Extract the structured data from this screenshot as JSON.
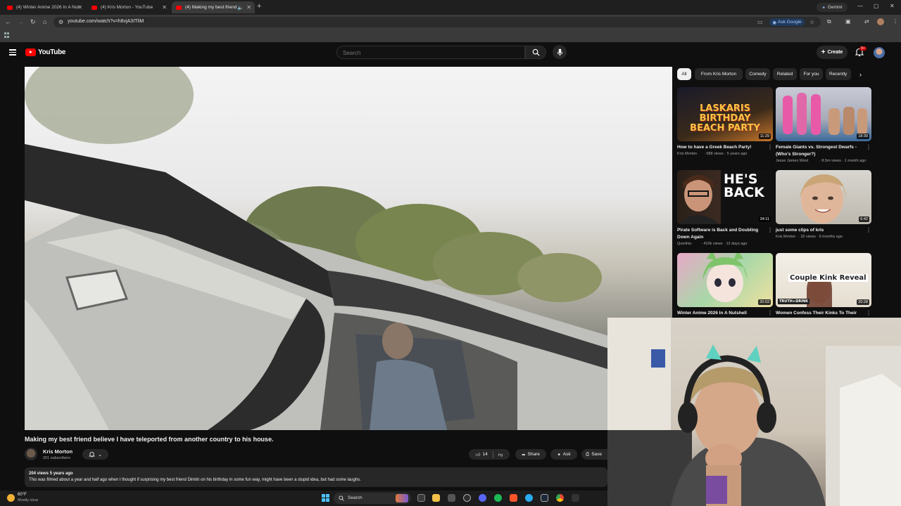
{
  "browser": {
    "tabs": [
      {
        "title": "(4) Winter Anime 2026 In A Nut",
        "active": false
      },
      {
        "title": "(4) Kris Morton - YouTube",
        "active": false
      },
      {
        "title": "(4) Making my best friend",
        "active": true
      }
    ],
    "gemini_label": "Gemini",
    "url": "youtube.com/watch?v=h8vjA3ITliM",
    "ask_google_label": "Ask Google"
  },
  "youtube": {
    "logo_text": "YouTube",
    "search_placeholder": "Search",
    "create_label": "Create",
    "notification_count": "9+"
  },
  "video": {
    "title": "Making my best friend believe I have teleported from another country to his house.",
    "channel_name": "Kris Morton",
    "subscribers": "201 subscribers",
    "likes": "14",
    "share_label": "Share",
    "ask_label": "Ask",
    "save_label": "Save",
    "views_date": "204 views  5 years ago",
    "description": "This was filmed about a year and half ago when I thought if surprising my best friend Dimitri on his birthday in some fun way, might have been a stupid idea, but had some laughs."
  },
  "chips": [
    "All",
    "From Kris Morton",
    "Comedy",
    "Related",
    "For you",
    "Recently"
  ],
  "recommendations": [
    {
      "title": "How to have a Greek Beach Party!",
      "channel": "Kris Morton",
      "meta": "588 views · 5 years ago",
      "duration": "11:29",
      "thumb_text": "LASKARIS BIRTHDAY BEACH PARTY"
    },
    {
      "title": "Female Giants vs. Strongest Dwarfs - (Who's Stronger?)",
      "channel": "Jesse James West",
      "meta": "8.5m views · 1 month ago",
      "duration": "18:30",
      "thumb_text": ""
    },
    {
      "title": "Pirate Software is Back and Doubling Down Again",
      "channel": "Quinthio",
      "meta": "410k views · 12 days ago",
      "duration": "34:11",
      "thumb_text": "HE'S BACK"
    },
    {
      "title": "just some clips of kris",
      "channel": "Kris Morton",
      "meta": "32 views · 9 months ago",
      "duration": "6:42",
      "thumb_text": ""
    },
    {
      "title": "Winter Anime 2026 In A Nutshell",
      "channel": "",
      "meta": "",
      "duration": "20:03",
      "thumb_text": ""
    },
    {
      "title": "Women Confess Their Kinks To Their",
      "channel": "",
      "meta": "",
      "duration": "20:28",
      "thumb_text": "Couple Kink Reveal",
      "badge_text": "TRUTH+DRINK"
    }
  ],
  "taskbar": {
    "temperature": "60°F",
    "weather": "Mostly clear",
    "search_label": "Search"
  },
  "colors": {
    "yt_red": "#ff0000",
    "background": "#0f0f0f",
    "chip_bg": "#272727",
    "accent_blue": "#a8c7fa"
  }
}
